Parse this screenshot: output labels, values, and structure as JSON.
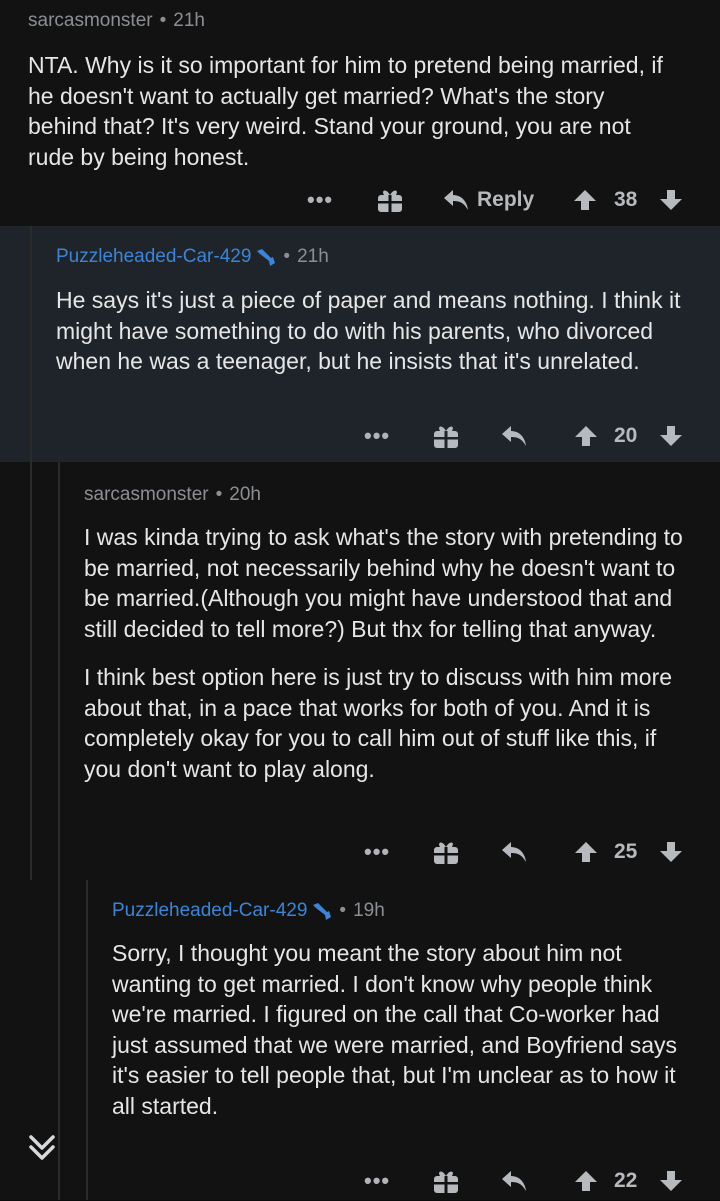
{
  "comments": [
    {
      "author": "sarcasmonster",
      "time": "21h",
      "is_op": false,
      "paragraphs": [
        "NTA. Why is it so important for him to pretend being married, if he doesn't want to actually get married? What's the story behind that? It's very weird. Stand your ground, you are not rude by being honest."
      ],
      "reply_label": "Reply",
      "score": "38"
    },
    {
      "author": "Puzzleheaded-Car-429",
      "time": "21h",
      "is_op": true,
      "paragraphs": [
        "He says it's just a piece of paper and means nothing. I think it might have something to do with his parents, who divorced when he was a teenager, but he insists that it's unrelated."
      ],
      "score": "20"
    },
    {
      "author": "sarcasmonster",
      "time": "20h",
      "is_op": false,
      "paragraphs": [
        "I was kinda trying to ask what's the story with pretending to be married, not necessarily behind why he doesn't want to be married.(Although you might have understood that and still decided to tell more?) But thx for telling that anyway.",
        "I think best option here is just try to discuss with him more about that, in a pace that works for both of you. And it is completely okay for you to call him out of stuff like this, if you don't want to play along."
      ],
      "score": "25"
    },
    {
      "author": "Puzzleheaded-Car-429",
      "time": "19h",
      "is_op": true,
      "paragraphs": [
        "Sorry, I thought you meant the story about him not wanting to get married. I don't know why people think we're married. I figured on the call that Co-worker had just assumed that we were married, and Boyfriend says it's easier to tell people that, but I'm unclear as to how it all started."
      ],
      "score": "22"
    }
  ],
  "ui": {
    "more_label": "•••",
    "separator": "•",
    "icons": {
      "more": "more-dots-icon",
      "award": "gift-award-icon",
      "reply": "reply-arrow-icon",
      "upvote": "upvote-arrow-icon",
      "downvote": "downvote-arrow-icon",
      "moderator": "mod-wrench-icon",
      "collapse": "collapse-chevrons-icon"
    },
    "colors": {
      "op_author": "#3d84d6",
      "author": "#8b8f94",
      "text": "#e6e6e6",
      "highlight_bg": "#1f242b",
      "bg": "#121212"
    }
  }
}
